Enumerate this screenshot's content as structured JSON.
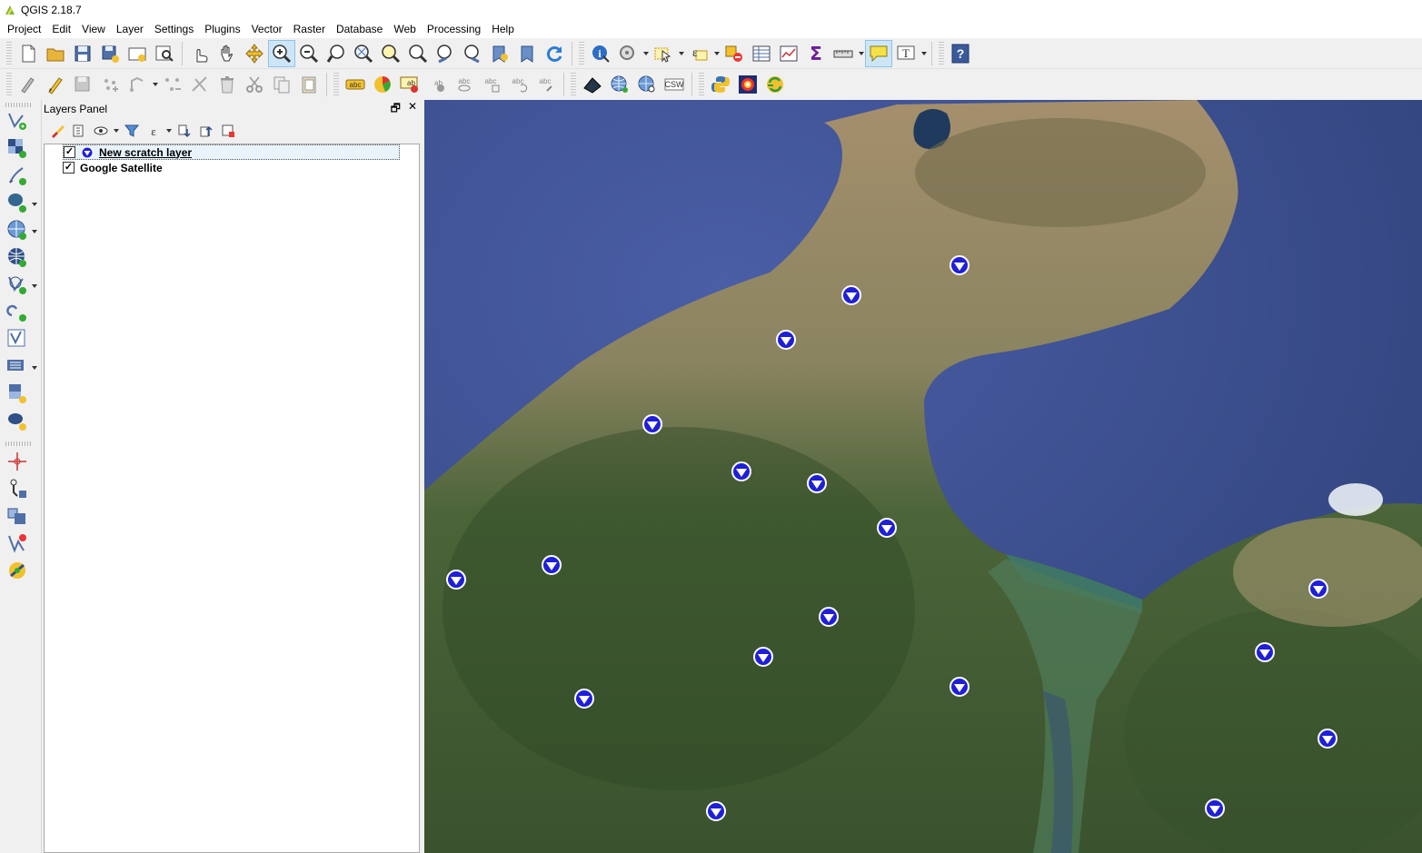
{
  "window": {
    "title": "QGIS 2.18.7"
  },
  "menu": [
    "Project",
    "Edit",
    "View",
    "Layer",
    "Settings",
    "Plugins",
    "Vector",
    "Raster",
    "Database",
    "Web",
    "Processing",
    "Help"
  ],
  "toolbar1": {
    "file": [
      "new-project-icon",
      "open-project-icon",
      "save-project-icon",
      "save-as-icon",
      "new-print-composer-icon",
      "composer-manager-icon"
    ],
    "nav": [
      "touch-zoom-icon",
      "pan-icon",
      "pan-to-selection-icon",
      "zoom-in-icon",
      "zoom-out-icon",
      "zoom-actual-icon",
      "zoom-full-icon",
      "zoom-to-selection-icon",
      "zoom-to-layer-icon",
      "zoom-last-icon",
      "zoom-next-icon",
      "new-bookmark-icon",
      "show-bookmarks-icon",
      "refresh-icon"
    ],
    "attr": [
      "identify-icon",
      "action-icon",
      "select-icon",
      "select-by-expression-icon",
      "deselect-icon",
      "attribute-table-icon",
      "statistics-icon",
      "sum-icon",
      "measure-icon",
      "map-tips-icon",
      "text-annotation-icon"
    ],
    "help": [
      "help-icon"
    ]
  },
  "toolbar2": {
    "csw_label": "CSW"
  },
  "layers_panel": {
    "title": "Layers Panel",
    "layers": [
      {
        "name": "New scratch layer",
        "checked": true,
        "selected": true
      },
      {
        "name": "Google Satellite",
        "checked": true,
        "selected": false
      }
    ]
  },
  "colors": {
    "sea": "#3e4f92",
    "land_green": "#3f5a32",
    "land_tan": "#a48d6a",
    "marker_fill": "#1f1fd8",
    "selection": "#e9f3fc"
  },
  "map_points_count": 20
}
